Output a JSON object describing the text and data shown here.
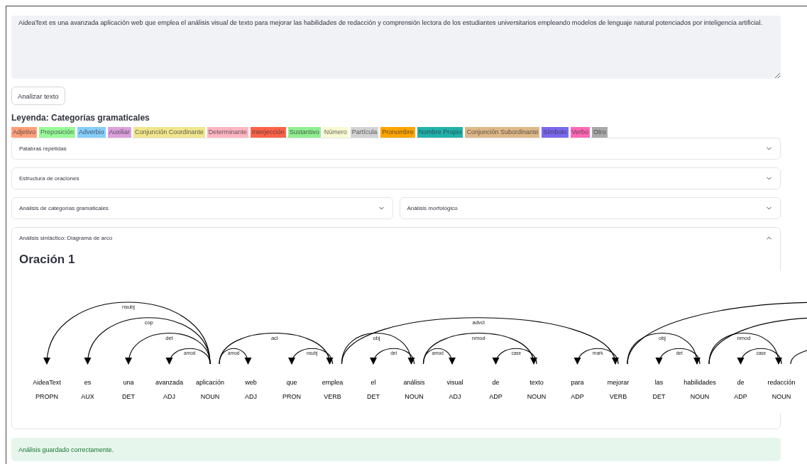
{
  "input_text": {
    "value": "AideaText es una avanzada aplicación web que emplea el análisis visual de texto para mejorar las habilidades de redacción y comprensión lectora de los estudiantes universitarios empleando modelos de lenguaje natural potenciados por inteligencia artificial."
  },
  "analyze_button": "Analizar texto",
  "legend": {
    "title": "Leyenda: Categorías gramaticales",
    "items": [
      {
        "label": "Adjetivo",
        "color": "#ffa07a"
      },
      {
        "label": "Preposición",
        "color": "#98fb98"
      },
      {
        "label": "Adverbio",
        "color": "#87cefa"
      },
      {
        "label": "Auxiliar",
        "color": "#dda0dd"
      },
      {
        "label": "Conjunción Coordinante",
        "color": "#f0e68c"
      },
      {
        "label": "Determinante",
        "color": "#ffb6c1"
      },
      {
        "label": "Interjección",
        "color": "#ff6347"
      },
      {
        "label": "Sustantivo",
        "color": "#90ee90"
      },
      {
        "label": "Número",
        "color": "#fafad2"
      },
      {
        "label": "Partícula",
        "color": "#d3d3d3"
      },
      {
        "label": "Pronombre",
        "color": "#ffa500"
      },
      {
        "label": "Nombre Propio",
        "color": "#20b2aa"
      },
      {
        "label": "Conjunción Subordinante",
        "color": "#deb887"
      },
      {
        "label": "Símbolo",
        "color": "#7b68ee"
      },
      {
        "label": "Verbo",
        "color": "#ff69b4"
      },
      {
        "label": "Otro",
        "color": "#a9a9a9"
      }
    ]
  },
  "expander_rows": [
    [
      {
        "title": "Palabras repetidas",
        "expanded": false
      }
    ],
    [
      {
        "title": "Estructura de oraciones",
        "expanded": false
      }
    ],
    [
      {
        "title": "Análisis de categorías gramaticales",
        "expanded": false
      },
      {
        "title": "Análisis morfológico",
        "expanded": false
      }
    ],
    [
      {
        "title": "Análisis sintáctico: Diagrama de arco",
        "expanded": true,
        "heading": "Oración 1",
        "diagram": {
          "words": [
            {
              "text": "AideaText",
              "tag": "PROPN"
            },
            {
              "text": "es",
              "tag": "AUX"
            },
            {
              "text": "una",
              "tag": "DET"
            },
            {
              "text": "avanzada",
              "tag": "ADJ"
            },
            {
              "text": "aplicación",
              "tag": "NOUN"
            },
            {
              "text": "web",
              "tag": "ADJ"
            },
            {
              "text": "que",
              "tag": "PRON"
            },
            {
              "text": "emplea",
              "tag": "VERB"
            },
            {
              "text": "el",
              "tag": "DET"
            },
            {
              "text": "análisis",
              "tag": "NOUN"
            },
            {
              "text": "visual",
              "tag": "ADJ"
            },
            {
              "text": "de",
              "tag": "ADP"
            },
            {
              "text": "texto",
              "tag": "NOUN"
            },
            {
              "text": "para",
              "tag": "ADP"
            },
            {
              "text": "mejorar",
              "tag": "VERB"
            },
            {
              "text": "las",
              "tag": "DET"
            },
            {
              "text": "habilidades",
              "tag": "NOUN"
            },
            {
              "text": "de",
              "tag": "ADP"
            },
            {
              "text": "redacción",
              "tag": "NOUN"
            }
          ],
          "arc_labels": [
            "nsubj",
            "cop",
            "det",
            "amod",
            "amod",
            "nsubj",
            "acl",
            "obj",
            "det",
            "amod",
            "case",
            "nmod",
            "mark",
            "advcl",
            "obj",
            "det",
            "case",
            "nmod"
          ]
        }
      }
    ]
  ],
  "status": {
    "kind": "success",
    "text": "Análisis guardado correctamente."
  }
}
